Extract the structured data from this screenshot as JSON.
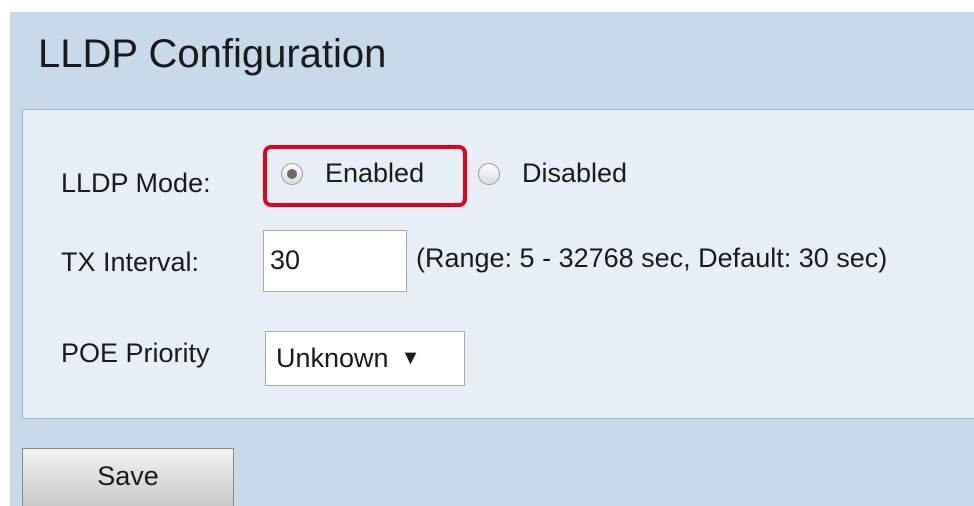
{
  "page": {
    "title": "LLDP Configuration"
  },
  "form": {
    "lldp_mode": {
      "label": "LLDP Mode:",
      "options": [
        {
          "label": "Enabled",
          "selected": true
        },
        {
          "label": "Disabled",
          "selected": false
        }
      ]
    },
    "tx_interval": {
      "label": "TX Interval:",
      "value": "30",
      "hint": "(Range: 5 - 32768 sec, Default: 30 sec)"
    },
    "poe_priority": {
      "label": "POE Priority",
      "selected_value": "Unknown"
    }
  },
  "actions": {
    "save_label": "Save"
  },
  "colors": {
    "background": "#c7d9ea",
    "panel": "#e7eef6",
    "highlight": "#e3001b"
  },
  "icons": {
    "dropdown": "triangle-down-icon"
  }
}
